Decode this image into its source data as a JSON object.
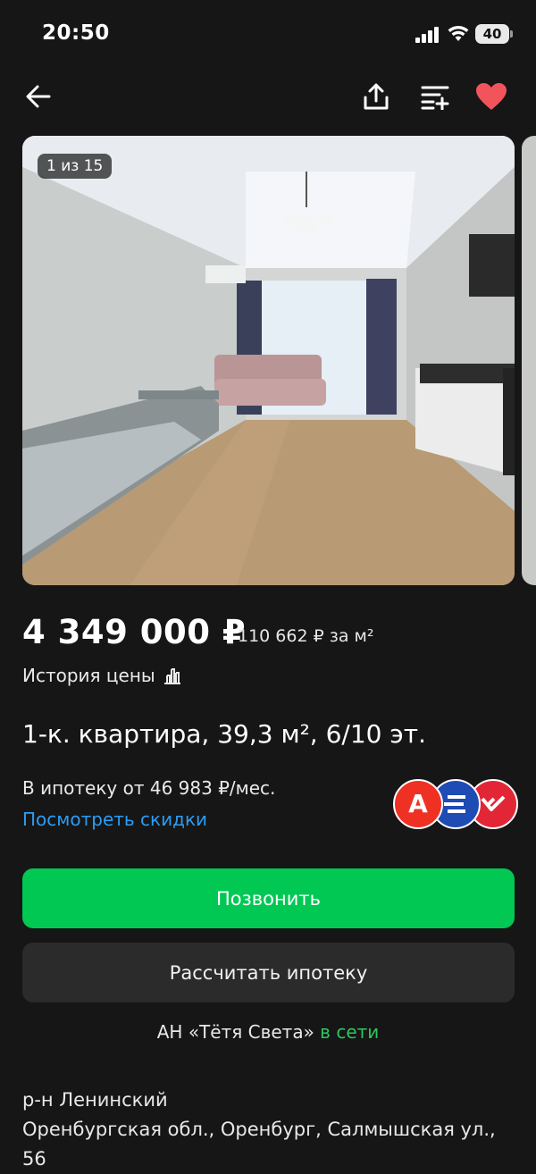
{
  "status": {
    "time": "20:50",
    "battery": "40"
  },
  "gallery": {
    "counter": "1 из 15"
  },
  "listing": {
    "price": "4 349 000 ₽",
    "price_per_m2": "110 662 ₽ за м²",
    "price_history_label": "История цены",
    "title": "1-к. квартира, 39,3 м², 6/10 эт.",
    "mortgage_text": "В ипотеку от 46 983 ₽/мес.",
    "discounts_link": "Посмотреть скидки"
  },
  "actions": {
    "call_label": "Позвонить",
    "calc_label": "Рассчитать ипотеку"
  },
  "agency": {
    "name": "АН «Тётя Света»",
    "status": "в сети"
  },
  "address": {
    "district": "р-н Ленинский",
    "line": "Оренбургская обл., Оренбург, Салмышская ул., 56"
  },
  "banks": [
    {
      "icon": "alfa-bank-logo",
      "letter": "А",
      "color": "#ef3124"
    },
    {
      "icon": "gazprom-bank-logo",
      "color": "#1e4bb4"
    },
    {
      "icon": "pochta-bank-logo",
      "color": "#e32636"
    }
  ],
  "colors": {
    "accent_green": "#00c853",
    "link_blue": "#2b9df4",
    "favorite_red": "#f2545b",
    "background": "#161616"
  }
}
